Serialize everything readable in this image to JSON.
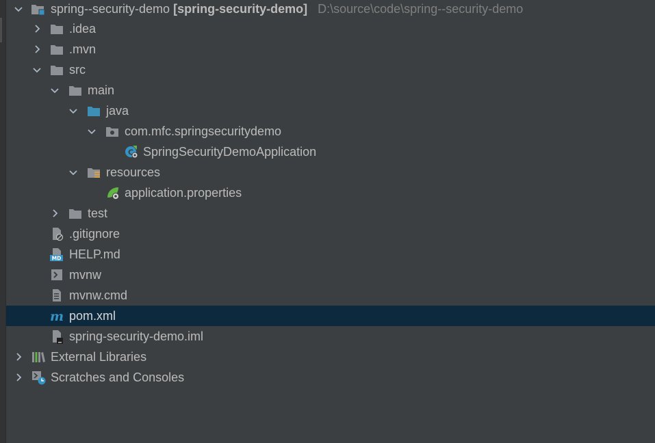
{
  "project": {
    "name": "spring--security-demo",
    "module": "[spring-security-demo]",
    "path": "D:\\source\\code\\spring--security-demo"
  },
  "tree": {
    "idea": ".idea",
    "mvn": ".mvn",
    "src": "src",
    "main": "main",
    "java": "java",
    "package": "com.mfc.springsecuritydemo",
    "app_class": "SpringSecurityDemoApplication",
    "resources": "resources",
    "app_props": "application.properties",
    "test": "test",
    "gitignore": ".gitignore",
    "help": "HELP.md",
    "mvnw": "mvnw",
    "mvnw_cmd": "mvnw.cmd",
    "pom": "pom.xml",
    "iml": "spring-security-demo.iml",
    "external_libraries": "External Libraries",
    "scratches": "Scratches and Consoles"
  },
  "icons": {
    "folder": "folder-icon",
    "source_folder": "source-folder-icon",
    "package": "package-icon",
    "spring_boot_class": "spring-boot-class-icon",
    "resources_folder": "resources-folder-icon",
    "spring_properties": "spring-properties-icon",
    "gitignore_file": "ignore-file-icon",
    "markdown_file": "markdown-file-icon",
    "shell_file": "shell-script-icon",
    "text_file": "text-file-icon",
    "maven_file": "maven-icon",
    "iml_file": "module-file-icon",
    "libraries": "libraries-icon",
    "scratches": "scratches-icon"
  },
  "colors": {
    "background": "#3c3f41",
    "selection": "#0d293e",
    "text": "#bbbbbb",
    "path_text": "#7f7f7f",
    "folder": "#8e9296",
    "source_folder": "#3d8fb5",
    "spring_green": "#62b543",
    "maven_blue": "#3592c4"
  }
}
